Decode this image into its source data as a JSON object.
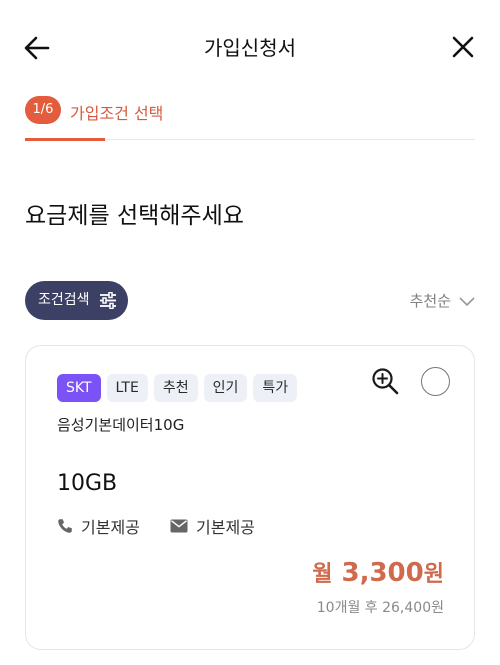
{
  "header": {
    "title": "가입신청서",
    "back_icon": "arrow-left-icon",
    "close_icon": "close-icon"
  },
  "progress": {
    "step_text": "1/6",
    "current_step": 1,
    "total_steps": 6,
    "step_label": "가입조건 선택",
    "accent_color": "#e25c3d"
  },
  "main": {
    "title": "요금제를 선택해주세요"
  },
  "toolbar": {
    "filter_label": "조건검색",
    "filter_icon": "sliders-icon",
    "sort_label": "추천순",
    "sort_icon": "chevron-down-icon"
  },
  "plans": [
    {
      "tags": [
        "SKT",
        "LTE",
        "추천",
        "인기",
        "특가"
      ],
      "name": "음성기본데이터10G",
      "data": "10GB",
      "voice_label": "기본제공",
      "sms_label": "기본제공",
      "price_prefix": "월",
      "price_value": "3,300",
      "price_unit": "원",
      "price_after": "10개월 후 26,400원",
      "selected": false,
      "price_color": "#cf6a4d",
      "tag_primary_color": "#7a52f5"
    }
  ]
}
